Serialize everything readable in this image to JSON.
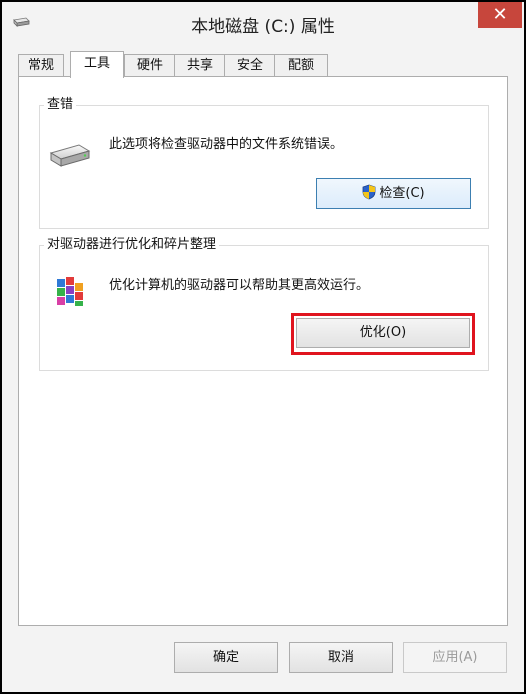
{
  "window": {
    "title": "本地磁盘 (C:) 属性",
    "close_glyph": "✕"
  },
  "tabs": [
    {
      "label": "常规"
    },
    {
      "label": "工具"
    },
    {
      "label": "硬件"
    },
    {
      "label": "共享"
    },
    {
      "label": "安全"
    },
    {
      "label": "配额"
    }
  ],
  "active_tab": "工具",
  "error_check": {
    "title": "查错",
    "description": "此选项将检查驱动器中的文件系统错误。",
    "button_label": "检查(C)",
    "icon": "hard-drive-icon",
    "button_icon": "uac-shield-icon"
  },
  "optimize": {
    "title": "对驱动器进行优化和碎片整理",
    "description": "优化计算机的驱动器可以帮助其更高效运行。",
    "button_label": "优化(O)",
    "icon": "defrag-icon"
  },
  "footer": {
    "ok_label": "确定",
    "cancel_label": "取消",
    "apply_label": "应用(A)"
  },
  "colors": {
    "close_button": "#c7463c",
    "highlight": "#e0141e",
    "focus_border": "#3c7fb1"
  }
}
